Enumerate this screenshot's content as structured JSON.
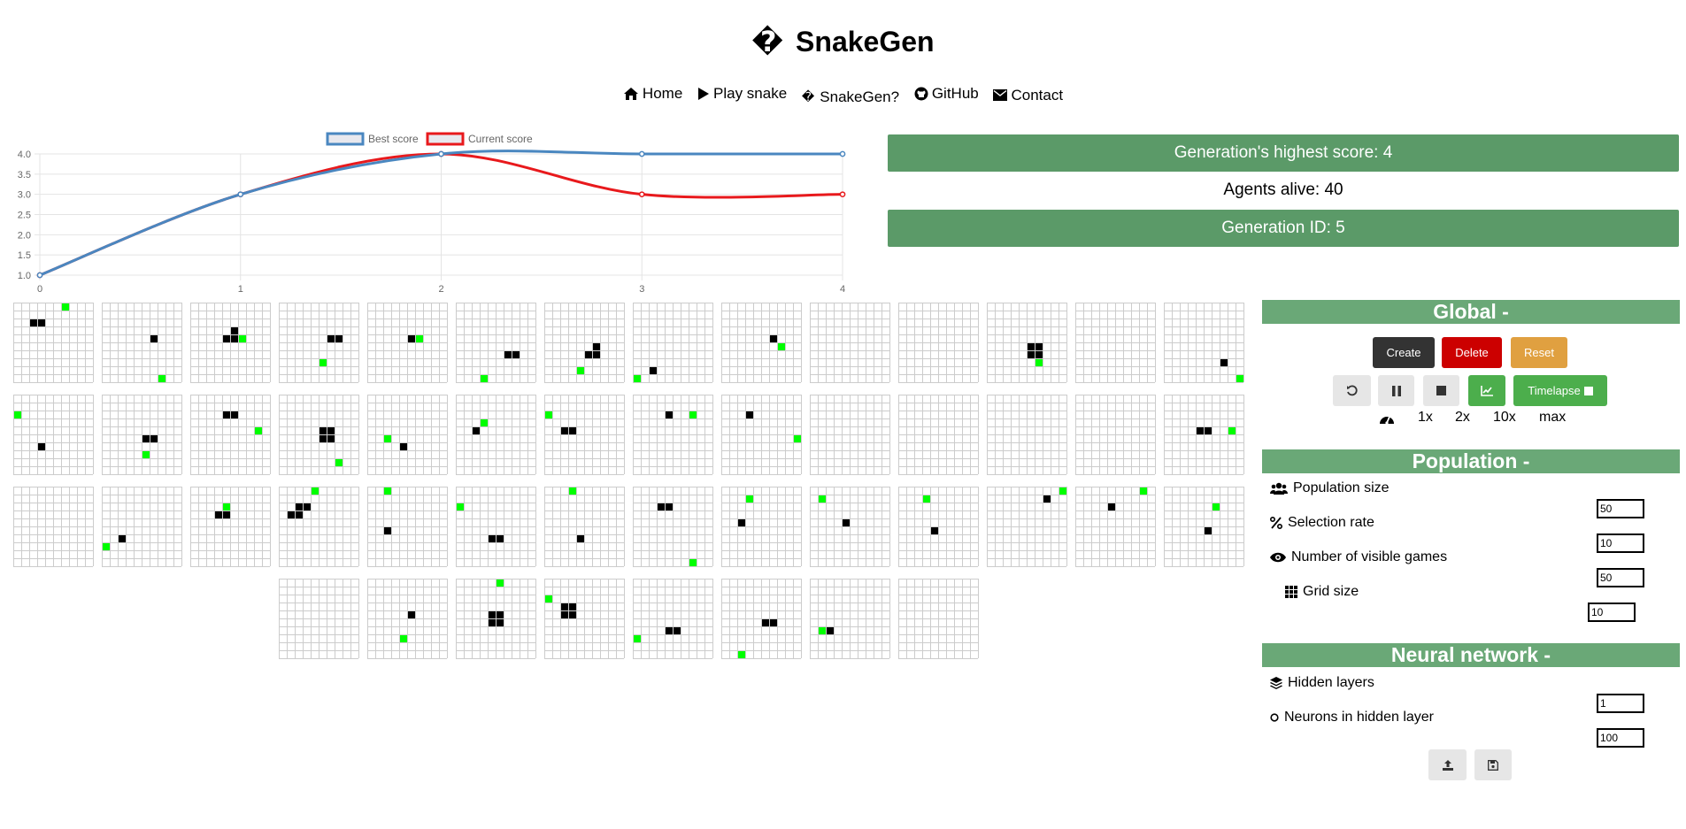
{
  "header": {
    "logo_glyph": "�",
    "title": "SnakeGen"
  },
  "nav": {
    "home": "Home",
    "play": "Play snake",
    "snakegen_glyph": "�",
    "snakegen": "SnakeGen?",
    "github": "GitHub",
    "contact": "Contact"
  },
  "stats": {
    "highest": "Generation's highest score: 4",
    "alive": "Agents alive: 40",
    "generation": "Generation ID: 5"
  },
  "chart_data": {
    "type": "line",
    "x": [
      0,
      1,
      2,
      3,
      4
    ],
    "series": [
      {
        "name": "Best score",
        "values": [
          1,
          3,
          4,
          4,
          4
        ],
        "color": "#4a87c0"
      },
      {
        "name": "Current score",
        "values": [
          1,
          3,
          4,
          3,
          3
        ],
        "color": "#e8191c"
      }
    ],
    "xticks": [
      "0",
      "1",
      "2",
      "3",
      "4"
    ],
    "yticks": [
      "1.0",
      "1.5",
      "2.0",
      "2.5",
      "3.0",
      "3.5",
      "4.0"
    ],
    "ylim": [
      1,
      4
    ],
    "grid": true,
    "legend": "top-center"
  },
  "games": [
    {
      "food": [
        [
          6,
          0
        ]
      ],
      "snake": [
        [
          2,
          2
        ],
        [
          3,
          2
        ]
      ]
    },
    {
      "food": [
        [
          7,
          9
        ]
      ],
      "snake": [
        [
          6,
          4
        ]
      ]
    },
    {
      "food": [
        [
          6,
          4
        ]
      ],
      "snake": [
        [
          5,
          3
        ],
        [
          4,
          4
        ],
        [
          5,
          4
        ]
      ]
    },
    {
      "food": [
        [
          5,
          7
        ]
      ],
      "snake": [
        [
          6,
          4
        ],
        [
          7,
          4
        ]
      ]
    },
    {
      "food": [
        [
          6,
          4
        ]
      ],
      "snake": [
        [
          5,
          4
        ]
      ]
    },
    {
      "food": [
        [
          3,
          9
        ]
      ],
      "snake": [
        [
          6,
          6
        ],
        [
          7,
          6
        ]
      ]
    },
    {
      "food": [
        [
          4,
          8
        ]
      ],
      "snake": [
        [
          6,
          5
        ],
        [
          5,
          6
        ],
        [
          6,
          6
        ]
      ]
    },
    {
      "food": [
        [
          0,
          9
        ]
      ],
      "snake": [
        [
          2,
          8
        ]
      ]
    },
    {
      "food": [
        [
          7,
          5
        ]
      ],
      "snake": [
        [
          6,
          4
        ]
      ]
    },
    {
      "food": [],
      "snake": []
    },
    {
      "food": [],
      "snake": []
    },
    {
      "food": [
        [
          6,
          7
        ]
      ],
      "snake": [
        [
          5,
          5
        ],
        [
          6,
          5
        ],
        [
          5,
          6
        ],
        [
          6,
          6
        ]
      ]
    },
    {
      "food": [],
      "snake": []
    },
    {
      "food": [
        [
          9,
          9
        ]
      ],
      "snake": [
        [
          7,
          7
        ]
      ]
    },
    {
      "food": [
        [
          0,
          2
        ]
      ],
      "snake": [
        [
          3,
          6
        ]
      ]
    },
    {
      "food": [
        [
          5,
          7
        ]
      ],
      "snake": [
        [
          5,
          5
        ],
        [
          6,
          5
        ]
      ]
    },
    {
      "food": [
        [
          8,
          4
        ]
      ],
      "snake": [
        [
          4,
          2
        ],
        [
          5,
          2
        ]
      ]
    },
    {
      "food": [
        [
          7,
          8
        ]
      ],
      "snake": [
        [
          5,
          4
        ],
        [
          6,
          4
        ],
        [
          5,
          5
        ],
        [
          6,
          5
        ]
      ]
    },
    {
      "food": [
        [
          2,
          5
        ]
      ],
      "snake": [
        [
          4,
          6
        ]
      ]
    },
    {
      "food": [
        [
          3,
          3
        ]
      ],
      "snake": [
        [
          2,
          4
        ]
      ]
    },
    {
      "food": [
        [
          0,
          2
        ]
      ],
      "snake": [
        [
          2,
          4
        ],
        [
          3,
          4
        ]
      ]
    },
    {
      "food": [
        [
          7,
          2
        ]
      ],
      "snake": [
        [
          4,
          2
        ]
      ]
    },
    {
      "food": [
        [
          9,
          5
        ]
      ],
      "snake": [
        [
          3,
          2
        ]
      ]
    },
    {
      "food": [],
      "snake": []
    },
    {
      "food": [],
      "snake": []
    },
    {
      "food": [],
      "snake": []
    },
    {
      "food": [],
      "snake": []
    },
    {
      "food": [
        [
          8,
          4
        ]
      ],
      "snake": [
        [
          4,
          4
        ],
        [
          5,
          4
        ]
      ]
    },
    {
      "food": [],
      "snake": []
    },
    {
      "food": [
        [
          0,
          7
        ]
      ],
      "snake": [
        [
          2,
          6
        ]
      ]
    },
    {
      "food": [
        [
          4,
          2
        ]
      ],
      "snake": [
        [
          3,
          3
        ],
        [
          4,
          3
        ]
      ]
    },
    {
      "food": [
        [
          4,
          0
        ]
      ],
      "snake": [
        [
          2,
          2
        ],
        [
          3,
          2
        ],
        [
          1,
          3
        ],
        [
          2,
          3
        ]
      ]
    },
    {
      "food": [
        [
          2,
          0
        ]
      ],
      "snake": [
        [
          2,
          5
        ]
      ]
    },
    {
      "food": [
        [
          0,
          2
        ]
      ],
      "snake": [
        [
          4,
          6
        ],
        [
          5,
          6
        ]
      ]
    },
    {
      "food": [
        [
          3,
          0
        ]
      ],
      "snake": [
        [
          4,
          6
        ]
      ]
    },
    {
      "food": [
        [
          7,
          9
        ]
      ],
      "snake": [
        [
          3,
          2
        ],
        [
          4,
          2
        ]
      ]
    },
    {
      "food": [
        [
          3,
          1
        ]
      ],
      "snake": [
        [
          2,
          4
        ]
      ]
    },
    {
      "food": [
        [
          1,
          1
        ]
      ],
      "snake": [
        [
          4,
          4
        ]
      ]
    },
    {
      "food": [
        [
          3,
          1
        ]
      ],
      "snake": [
        [
          4,
          5
        ]
      ]
    },
    {
      "food": [
        [
          9,
          0
        ]
      ],
      "snake": [
        [
          7,
          1
        ]
      ]
    },
    {
      "food": [
        [
          8,
          0
        ]
      ],
      "snake": [
        [
          4,
          2
        ]
      ]
    },
    {
      "food": [
        [
          6,
          2
        ]
      ],
      "snake": [
        [
          5,
          5
        ]
      ]
    },
    {
      "food": [],
      "snake": []
    },
    {
      "food": [
        [
          4,
          7
        ]
      ],
      "snake": [
        [
          5,
          4
        ]
      ]
    },
    {
      "food": [
        [
          5,
          0
        ]
      ],
      "snake": [
        [
          4,
          4
        ],
        [
          5,
          4
        ],
        [
          4,
          5
        ],
        [
          5,
          5
        ]
      ]
    },
    {
      "food": [
        [
          0,
          2
        ]
      ],
      "snake": [
        [
          2,
          3
        ],
        [
          3,
          3
        ],
        [
          2,
          4
        ],
        [
          3,
          4
        ]
      ]
    },
    {
      "food": [
        [
          0,
          7
        ]
      ],
      "snake": [
        [
          4,
          6
        ],
        [
          5,
          6
        ]
      ]
    },
    {
      "food": [
        [
          2,
          9
        ]
      ],
      "snake": [
        [
          5,
          5
        ],
        [
          6,
          5
        ]
      ]
    },
    {
      "food": [
        [
          1,
          6
        ]
      ],
      "snake": [
        [
          2,
          6
        ]
      ]
    },
    {
      "food": [],
      "snake": []
    }
  ],
  "global": {
    "header": "Global -",
    "create": "Create",
    "delete": "Delete",
    "reset": "Reset",
    "timelapse": "Timelapse",
    "speeds": [
      "1x",
      "2x",
      "10x",
      "max"
    ]
  },
  "population": {
    "header": "Population -",
    "size_label": "Population size",
    "size_value": "50",
    "selection_label": "Selection rate",
    "selection_value": "10",
    "visible_label": "Number of visible games",
    "visible_value": "50",
    "grid_label": "Grid size",
    "grid_value": "10"
  },
  "network": {
    "header": "Neural network -",
    "layers_label": "Hidden layers",
    "layers_value": "1",
    "neurons_label": "Neurons in hidden layer",
    "neurons_value": "100"
  },
  "colors": {
    "food": "#00ff00",
    "snake": "#000000",
    "bar": "#5b9a68",
    "header": "#6aa877"
  }
}
